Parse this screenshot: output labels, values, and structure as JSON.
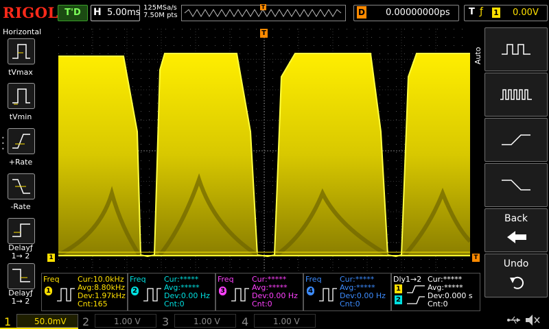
{
  "header": {
    "logo": "RIGOL",
    "trigger_status": "T'D",
    "timebase_label": "H",
    "timebase_value": "5.00ms",
    "sample_rate": "125MSa/s",
    "memory_depth": "7.50M pts",
    "delay_label": "D",
    "delay_value": "0.00000000ps",
    "trigger_label": "T",
    "trigger_edge": "ƒ",
    "trigger_channel": "1",
    "trigger_level": "0.00V",
    "mem_marker": "T"
  },
  "left_panel": {
    "title": "Horizontal",
    "buttons": [
      {
        "label": "tVmax"
      },
      {
        "label": "tVmin"
      },
      {
        "label": "+Rate"
      },
      {
        "label": "-Rate"
      },
      {
        "label": "Delayƒ",
        "sub": "1→ 2"
      },
      {
        "label": "Delayƒ",
        "sub": "1→ 2"
      }
    ]
  },
  "right_panel": {
    "mode": "Auto",
    "buttons": [
      {
        "name": "pulse-single"
      },
      {
        "name": "pulse-burst"
      },
      {
        "name": "rising-edge"
      },
      {
        "name": "falling-edge"
      },
      {
        "label": "Back"
      },
      {
        "label": "Undo"
      }
    ]
  },
  "markers": {
    "ch1": "1",
    "trig_right": "T",
    "trig_top": "T"
  },
  "measurements": [
    {
      "title": "Freq",
      "channel": "1",
      "cur": "Cur:10.0kHz",
      "avg": "Avg:8.80kHz",
      "dev": "Dev:1.97kHz",
      "cnt": "Cnt:165",
      "color": "#ffe000"
    },
    {
      "title": "Freq",
      "channel": "2",
      "cur": "Cur:*****",
      "avg": "Avg:*****",
      "dev": "Dev:0.00 Hz",
      "cnt": "Cnt:0",
      "color": "#00e0e0"
    },
    {
      "title": "Freq",
      "channel": "3",
      "cur": "Cur:*****",
      "avg": "Avg:*****",
      "dev": "Dev:0.00 Hz",
      "cnt": "Cnt:0",
      "color": "#ff40ff"
    },
    {
      "title": "Freq",
      "channel": "4",
      "cur": "Cur:*****",
      "avg": "Avg:*****",
      "dev": "Dev:0.00 Hz",
      "cnt": "Cnt:0",
      "color": "#3c8cff"
    },
    {
      "title": "Dly1→2",
      "channel": "1",
      "channel2": "2",
      "cur": "Cur:*****",
      "avg": "Avg:*****",
      "dev": "Dev:0.000 s",
      "cnt": "Cnt:0",
      "color": "#ffffff"
    }
  ],
  "channels": [
    {
      "num": "1",
      "scale": "50.0mV",
      "color": "#ffe000"
    },
    {
      "num": "2",
      "scale": "1.00 V",
      "color": "#8a8a8a"
    },
    {
      "num": "3",
      "scale": "1.00 V",
      "color": "#8a8a8a"
    },
    {
      "num": "4",
      "scale": "1.00 V",
      "color": "#8a8a8a"
    }
  ],
  "colors": {
    "ch1": "#ffe000",
    "ch2": "#00e0e0",
    "ch3": "#ff40ff",
    "ch4": "#3c8cff",
    "trigger": "#ff8a00",
    "logo": "#ff2a1a"
  }
}
